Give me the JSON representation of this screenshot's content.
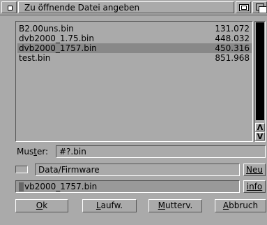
{
  "window": {
    "title": "Zu öffnende Datei angeben",
    "icons": [
      "close-icon",
      "zoom-icon",
      "depth-icon"
    ]
  },
  "files": [
    {
      "name": "B2.00uns.bin",
      "size": "131.072",
      "selected": false
    },
    {
      "name": "dvb2000_1.75.bin",
      "size": "448.032",
      "selected": false
    },
    {
      "name": "dvb2000_1757.bin",
      "size": "450.316",
      "selected": true
    },
    {
      "name": "test.bin",
      "size": "851.968",
      "selected": false
    }
  ],
  "scrollbar": {
    "up_glyph": "Λ",
    "down_glyph": "V"
  },
  "pattern": {
    "label_before": "Mus",
    "label_accel": "t",
    "label_after": "er:",
    "value": "#?.bin"
  },
  "drawer": {
    "value": "Data/Firmware",
    "new_button": "Neu"
  },
  "file": {
    "value": "vb2000_1757.bin",
    "info_button": "info"
  },
  "buttons": {
    "ok": {
      "accel": "O",
      "rest": "k"
    },
    "drives": {
      "accel": "L",
      "rest": "aufw."
    },
    "parent": {
      "accel": "M",
      "rest": "utterv."
    },
    "cancel": {
      "accel": "A",
      "rest": "bbruch"
    }
  }
}
